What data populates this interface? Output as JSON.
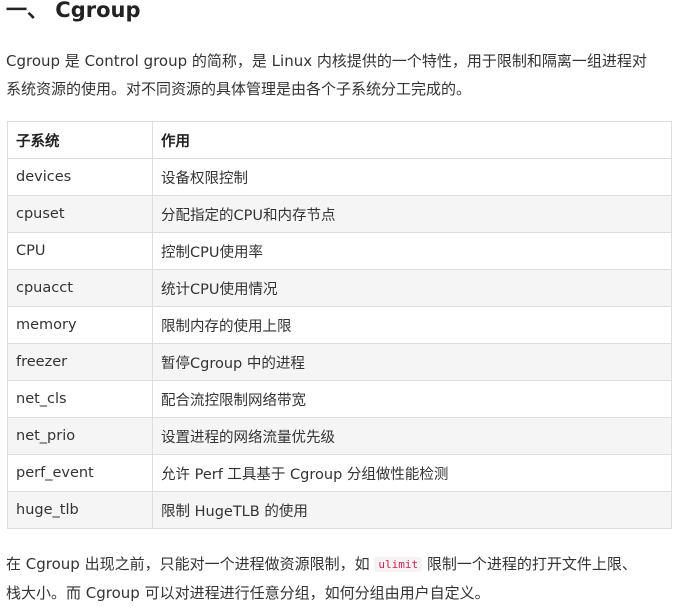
{
  "heading": "一、 Cgroup",
  "intro_line1": "Cgroup 是 Control group 的简称，是 Linux 内核提供的一个特性，用于限制和隔离一组进程对",
  "intro_line2": "系统资源的使用。对不同资源的具体管理是由各个子系统分工完成的。",
  "table": {
    "headers": [
      "子系统",
      "作用"
    ],
    "rows": [
      [
        "devices",
        "设备权限控制"
      ],
      [
        "cpuset",
        "分配指定的CPU和内存节点"
      ],
      [
        "CPU",
        "控制CPU使用率"
      ],
      [
        "cpuacct",
        "统计CPU使用情况"
      ],
      [
        "memory",
        "限制内存的使用上限"
      ],
      [
        "freezer",
        "暂停Cgroup 中的进程"
      ],
      [
        "net_cls",
        "配合流控限制网络带宽"
      ],
      [
        "net_prio",
        "设置进程的网络流量优先级"
      ],
      [
        "perf_event",
        "允许 Perf 工具基于 Cgroup 分组做性能检测"
      ],
      [
        "huge_tlb",
        "限制 HugeTLB 的使用"
      ]
    ]
  },
  "outro": {
    "before_code": "在 Cgroup 出现之前，只能对一个进程做资源限制，如 ",
    "code": "ulimit",
    "after_code": " 限制一个进程的打开文件上限、",
    "line2": "栈大小。而 Cgroup 可以对进程进行任意分组，如何分组由用户自定义。"
  }
}
